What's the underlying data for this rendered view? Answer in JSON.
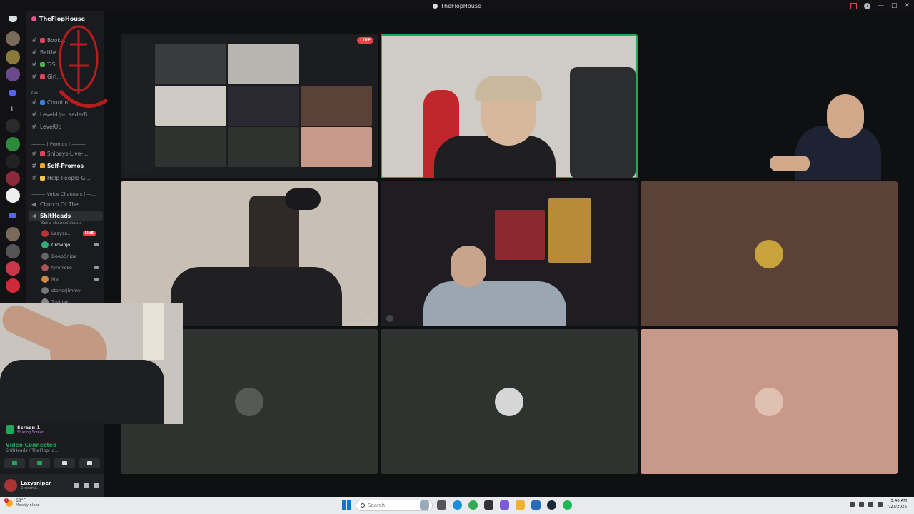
{
  "window": {
    "title": "TheFlopHouse"
  },
  "server": {
    "name": "TheFlopHouse"
  },
  "rail": {
    "letter": "L"
  },
  "channels": [
    {
      "name": "Book...",
      "color": "#e2455b"
    },
    {
      "name": "Battle...",
      "color": "#949ba4"
    },
    {
      "name": "T-S...",
      "color": "#4cb050"
    },
    {
      "name": "Girl...",
      "color": "#e2455b"
    },
    {
      "name": "Countin...",
      "color": "#3b7dd8"
    },
    {
      "name": "Level-Up-LeaderB...",
      "color": ""
    },
    {
      "name": "LevelUp",
      "color": ""
    }
  ],
  "categories": {
    "general": "Ge...",
    "promos": "——— | Promos | ———",
    "voice": "——— Voice Channels | —..."
  },
  "promo_channels": [
    {
      "name": "Snipeys-Live-...",
      "color": "#e2455b",
      "bold": false
    },
    {
      "name": "Self-Promos",
      "color": "#f5a623",
      "bold": true
    },
    {
      "name": "Help-People-G...",
      "color": "#f5c84c",
      "bold": false
    }
  ],
  "voice_channels": {
    "church": "Church Of The...",
    "active": "ShitHeads",
    "active_status": "Set a channel status"
  },
  "voice_users": [
    {
      "name": "Lazysn...",
      "live": true,
      "color": "#b33"
    },
    {
      "name": "Crownjo",
      "live": false,
      "color": "#3a7",
      "bright": true
    },
    {
      "name": "DeepSnipe",
      "live": false,
      "color": "#666"
    },
    {
      "name": "fyrefreke",
      "live": false,
      "color": "#a55"
    },
    {
      "name": "Mel",
      "live": false,
      "color": "#c84"
    },
    {
      "name": "stonerjimmy",
      "live": false,
      "color": "#777"
    },
    {
      "name": "Toshiaki",
      "live": false,
      "color": "#888"
    }
  ],
  "live_label": "LIVE",
  "screen_share": {
    "title": "Screen 1",
    "subtitle": "Sharing Screen"
  },
  "voice_status": {
    "title": "Video Connected",
    "subtitle": "ShitHeads / TheFlopHo..."
  },
  "user": {
    "name": "Lazysniper",
    "status": "Streami..."
  },
  "taskbar": {
    "weather_temp": "60°F",
    "weather_desc": "Mostly clear",
    "weather_badge": "1",
    "search_placeholder": "Search",
    "time": "5:40 AM",
    "date": "7/27/2025"
  },
  "colors": {
    "speaking": "#23a55a",
    "live": "#f23f43",
    "tile_dark": "#2f332f",
    "tile_brown": "#5a4238",
    "tile_pink": "#c8988a"
  }
}
